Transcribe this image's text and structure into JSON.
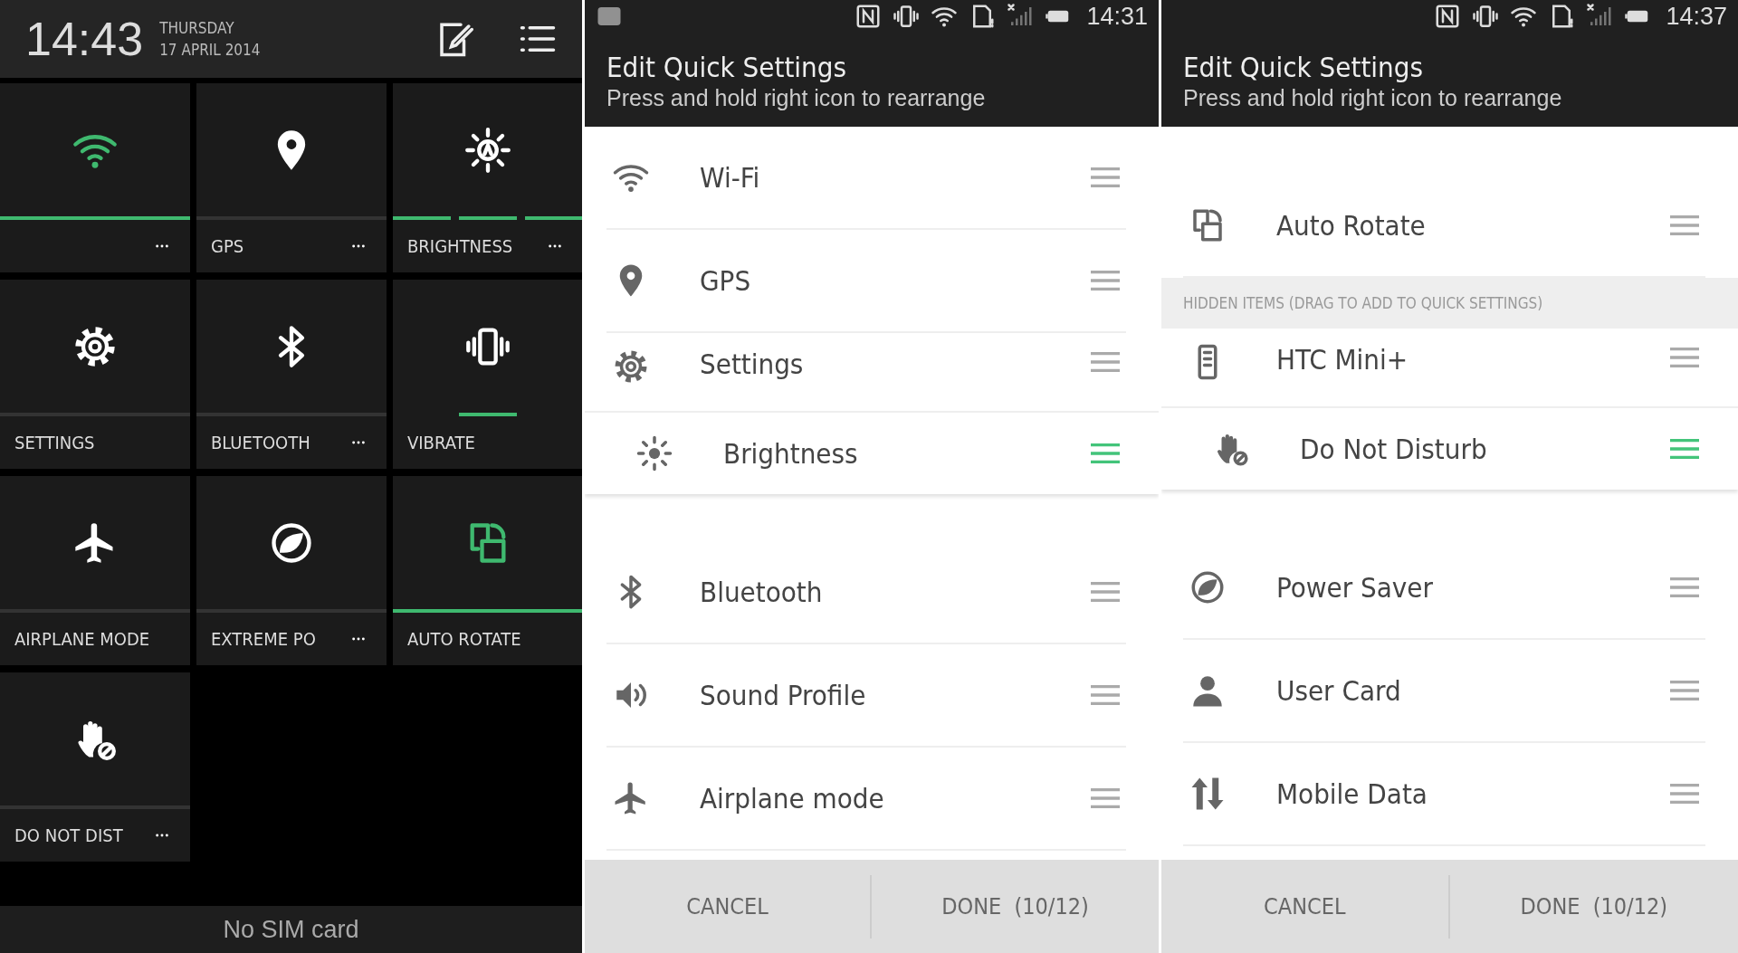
{
  "quick_settings_panel": {
    "clock": {
      "time": "14:43",
      "day": "THURSDAY",
      "date": "17 APRIL 2014"
    },
    "tiles": [
      {
        "on": true,
        "highlighted": true,
        "menu": true
      },
      {
        "label": "GPS",
        "on": false,
        "highlighted": false,
        "menu": true
      },
      {
        "label": "BRIGHTNESS",
        "on": true,
        "highlighted": false,
        "menu": true
      },
      {
        "label": "SETTINGS",
        "on": false,
        "highlighted": false,
        "menu": false
      },
      {
        "label": "BLUETOOTH",
        "on": false,
        "highlighted": false,
        "menu": true
      },
      {
        "label": "VIBRATE",
        "on": true,
        "highlighted": false,
        "menu": false
      },
      {
        "label": "AIRPLANE MODE",
        "on": false,
        "highlighted": false,
        "menu": false
      },
      {
        "label": "EXTREME PO",
        "on": false,
        "highlighted": false,
        "menu": true
      },
      {
        "label": "AUTO ROTATE",
        "on": true,
        "highlighted": true,
        "menu": false
      },
      {
        "label": "DO NOT DIST",
        "on": false,
        "highlighted": false,
        "menu": true
      }
    ],
    "footer": "No SIM card"
  },
  "edit_screens": [
    {
      "status_time": "14:31",
      "title": "Edit Quick Settings",
      "subtitle": "Press and hold right icon to rearrange",
      "items": [
        {
          "kind": "item",
          "label": "Wi-Fi",
          "dragging": false
        },
        {
          "kind": "item",
          "label": "GPS",
          "dragging": false
        },
        {
          "kind": "item",
          "label": "Settings",
          "dragging": false
        },
        {
          "kind": "item",
          "label": "Brightness",
          "dragging": true
        },
        {
          "kind": "item",
          "label": "Bluetooth",
          "dragging": false
        },
        {
          "kind": "item",
          "label": "Sound Profile",
          "dragging": false
        },
        {
          "kind": "item",
          "label": "Airplane mode",
          "dragging": false
        }
      ],
      "buttons": [
        {
          "label": "CANCEL"
        },
        {
          "label": "DONE  (10/12)"
        }
      ]
    },
    {
      "status_time": "14:37",
      "title": "Edit Quick Settings",
      "subtitle": "Press and hold right icon to rearrange",
      "items": [
        {
          "kind": "item",
          "label": "Auto Rotate",
          "dragging": false
        },
        {
          "kind": "section",
          "label": "HIDDEN ITEMS (DRAG TO ADD TO QUICK SETTINGS)"
        },
        {
          "kind": "item",
          "label": "HTC Mini+",
          "dragging": false
        },
        {
          "kind": "item",
          "label": "Do Not Disturb",
          "dragging": true
        },
        {
          "kind": "item",
          "label": "Power Saver",
          "dragging": false
        },
        {
          "kind": "item",
          "label": "User Card",
          "dragging": false
        },
        {
          "kind": "item",
          "label": "Mobile Data",
          "dragging": false
        }
      ],
      "buttons": [
        {
          "label": "CANCEL"
        },
        {
          "label": "DONE  (10/12)"
        }
      ]
    }
  ]
}
